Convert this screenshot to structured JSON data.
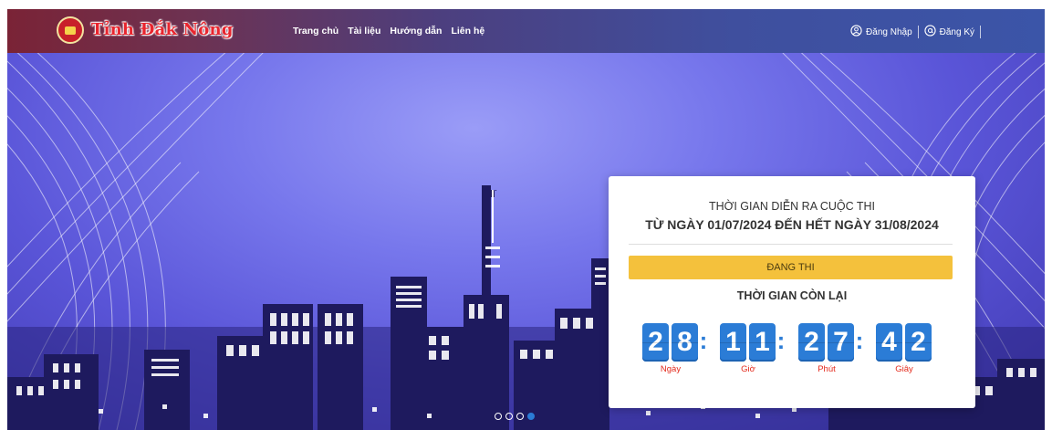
{
  "header": {
    "brand": "Tỉnh Đắk Nông",
    "nav": [
      "Trang chủ",
      "Tài liệu",
      "Hướng dẫn",
      "Liên hệ"
    ],
    "login_label": "Đăng Nhập",
    "register_label": "Đăng Ký"
  },
  "countdown": {
    "title": "THỜI GIAN DIỄN RA CUỘC THI",
    "range": "TỪ NGÀY 01/07/2024 ĐẾN HẾT NGÀY 31/08/2024",
    "status": "ĐANG THI",
    "remaining_label": "THỜI GIAN CÒN LẠI",
    "digits": [
      "2",
      "8",
      "1",
      "1",
      "2",
      "7",
      "4",
      "2"
    ],
    "units": [
      "Ngày",
      "Giờ",
      "Phút",
      "Giây"
    ]
  },
  "slider": {
    "count": 4,
    "active": 4
  },
  "colors": {
    "accent": "#2b7cd6",
    "status": "#f4c13c",
    "unit_label": "#e32a1c"
  }
}
